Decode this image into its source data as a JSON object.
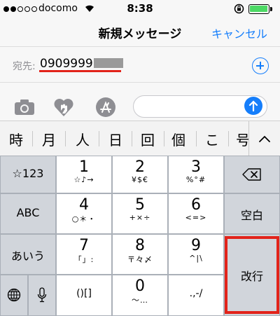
{
  "status": {
    "carrier": "docomo",
    "time": "8:38"
  },
  "nav": {
    "title": "新規メッセージ",
    "cancel_label": "キャンセル"
  },
  "recipient": {
    "to_label": "宛先:",
    "number": "0909999"
  },
  "candidates": [
    "時",
    "月",
    "人",
    "日",
    "回",
    "個",
    "こ",
    "号"
  ],
  "keyboard": {
    "left": {
      "numbers": "☆123",
      "abc": "ABC",
      "kana": "あいう"
    },
    "keys": [
      {
        "main": "1",
        "sub": "☆♪→"
      },
      {
        "main": "2",
        "sub": "¥$€"
      },
      {
        "main": "3",
        "sub": "%°#"
      },
      {
        "main": "4",
        "sub": "○＊・"
      },
      {
        "main": "5",
        "sub": "+×÷"
      },
      {
        "main": "6",
        "sub": "<=>"
      },
      {
        "main": "7",
        "sub": "「」:"
      },
      {
        "main": "8",
        "sub": "〒々〆"
      },
      {
        "main": "9",
        "sub": "^|\\"
      },
      {
        "main": "()[]",
        "sub": ""
      },
      {
        "main": "0",
        "sub": "〜…"
      },
      {
        "main": ".,-/",
        "sub": ""
      }
    ],
    "right": {
      "space": "空白",
      "return": "改行"
    }
  },
  "colors": {
    "accent": "#157efb",
    "highlight": "#e2231a",
    "battery": "#4cd964"
  }
}
